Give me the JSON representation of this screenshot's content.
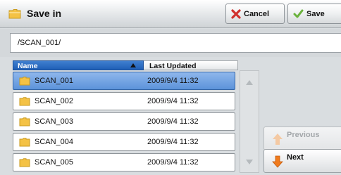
{
  "window": {
    "title": "Save in",
    "cancel_label": "Cancel",
    "save_label": "Save"
  },
  "path": {
    "value": "/SCAN_001/"
  },
  "table": {
    "columns": {
      "name": "Name",
      "updated": "Last Updated"
    },
    "sort_direction": "ascending",
    "rows": [
      {
        "name": "SCAN_001",
        "updated": "2009/9/4 11:32",
        "selected": true
      },
      {
        "name": "SCAN_002",
        "updated": "2009/9/4 11:32",
        "selected": false
      },
      {
        "name": "SCAN_003",
        "updated": "2009/9/4 11:32",
        "selected": false
      },
      {
        "name": "SCAN_004",
        "updated": "2009/9/4 11:32",
        "selected": false
      },
      {
        "name": "SCAN_005",
        "updated": "2009/9/4 11:32",
        "selected": false
      }
    ]
  },
  "pager": {
    "previous_label": "Previous",
    "next_label": "Next",
    "previous_enabled": false
  },
  "colors": {
    "selection": "#5c93da",
    "header": "#1f5fb6",
    "folder": "#f4c245",
    "cancel_icon": "#d0312d",
    "save_icon": "#6ab23c",
    "arrow": "#f07a1c"
  },
  "icons": [
    "folder-icon",
    "cancel-x-icon",
    "save-check-icon",
    "sort-up-icon",
    "scroll-up-icon",
    "scroll-down-icon",
    "arrow-up-icon",
    "arrow-down-icon"
  ]
}
